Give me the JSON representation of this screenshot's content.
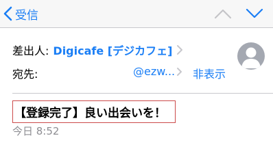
{
  "navbar": {
    "back_label": "受信",
    "prev_icon": "chevron-up-icon",
    "next_icon": "chevron-down-icon"
  },
  "header": {
    "from_label": "差出人:",
    "sender_name": "Digicafe [デジカフェ]",
    "to_label": "宛先:",
    "recipient_address": "@ezw...",
    "hide_label": "非表示"
  },
  "message": {
    "subject": "【登録完了】良い出会いを！",
    "date": "今日 8:52"
  },
  "colors": {
    "accent": "#1a7ef5",
    "secondary_text": "#8e8e93",
    "highlight_border": "#cc4a4a",
    "avatar_bg": "#a4a8b1"
  }
}
